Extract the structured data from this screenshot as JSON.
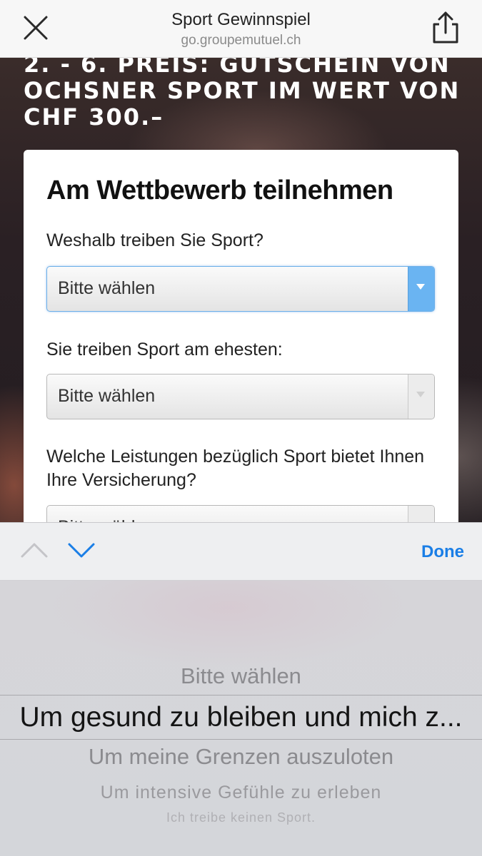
{
  "browser": {
    "title": "Sport Gewinnspiel",
    "url": "go.groupemutuel.ch",
    "close_icon": "close-icon",
    "share_icon": "share-icon"
  },
  "page": {
    "headline": "2. - 6. Preis: Gutschein von Ochsner Sport im Wert von CHF 300.–"
  },
  "form": {
    "title": "Am Wettbewerb teilnehmen",
    "questions": [
      {
        "label": "Weshalb treiben Sie Sport?",
        "value": "Bitte wählen"
      },
      {
        "label": "Sie treiben Sport am ehesten:",
        "value": "Bitte wählen"
      },
      {
        "label": "Welche Leistungen bezüglich Sport bietet Ihnen Ihre Versicherung?",
        "value": "Bitte wählen"
      }
    ]
  },
  "toolbar": {
    "prev_icon": "chevron-up-icon",
    "next_icon": "chevron-down-icon",
    "done_label": "Done"
  },
  "picker": {
    "options": [
      "Bitte wählen",
      "Um gesund zu bleiben und mich z...",
      "Um meine Grenzen auszuloten",
      "Um intensive Gefühle zu erleben",
      "Ich treibe keinen Sport."
    ],
    "selected_index": 1
  },
  "colors": {
    "accent": "#1a7ee6",
    "active_select": "#6ab4f2"
  }
}
